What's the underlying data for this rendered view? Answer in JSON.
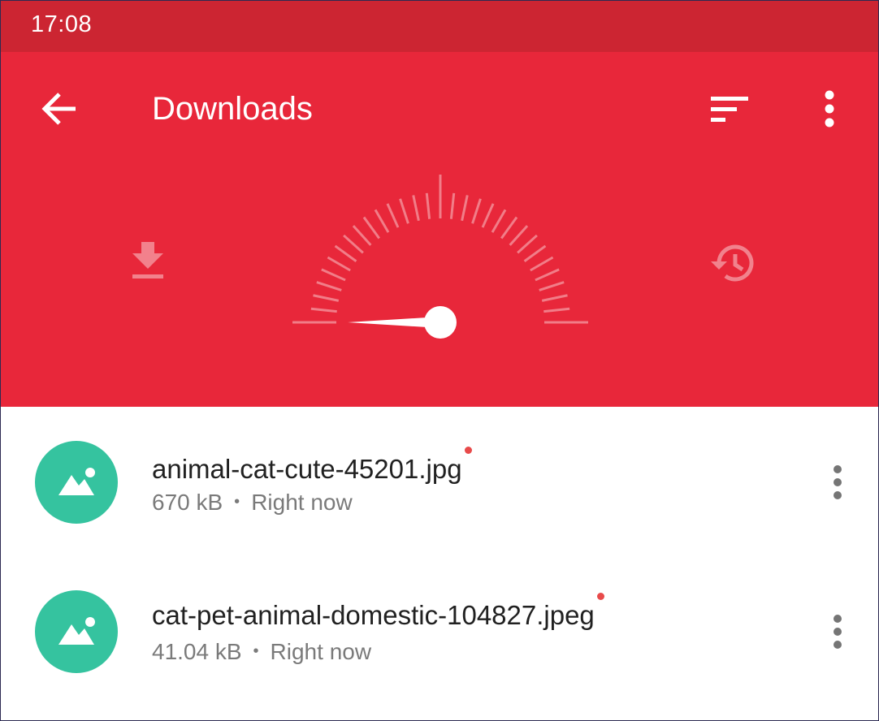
{
  "status_bar": {
    "time": "17:08",
    "icons": [
      "alarm-icon",
      "vibrate-icon",
      "wifi-icon",
      "signal-icon",
      "signal-2-icon",
      "battery-low-icon"
    ],
    "battery_color": "#f59b52"
  },
  "app_bar": {
    "title": "Downloads",
    "back_icon": "arrow-back-icon",
    "sort_icon": "sort-icon",
    "more_icon": "more-vert-icon",
    "background": "#e8273a"
  },
  "speed_panel": {
    "left_icon": "download-icon",
    "center_icon": "speedometer-gauge",
    "right_icon": "history-icon",
    "gauge_level": 0.0
  },
  "downloads": [
    {
      "filename": "animal-cat-cute-45201.jpg",
      "size": "670 kB",
      "separator": "•",
      "time": "Right now",
      "icon": "image-icon",
      "is_new": true
    },
    {
      "filename": "cat-pet-animal-domestic-104827.jpeg",
      "size": "41.04 kB",
      "separator": "•",
      "time": "Right now",
      "icon": "image-icon",
      "is_new": true
    }
  ],
  "colors": {
    "accent": "#e8273a",
    "status_bar": "#cc2532",
    "file_icon_bg": "#35c39f",
    "new_dot": "#e84a4a"
  }
}
